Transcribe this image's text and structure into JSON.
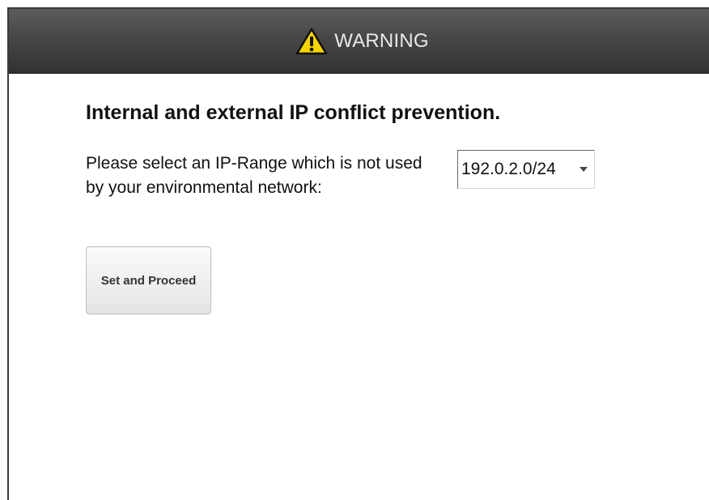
{
  "header": {
    "icon": "warning-triangle-icon",
    "icon_color": "#f5d300",
    "title": "WARNING"
  },
  "main": {
    "heading": "Internal and external IP conflict prevention.",
    "prompt": "Please select an IP-Range which is not used by your environmental network:",
    "ip_range_select": {
      "selected_value": "192.0.2.0/24"
    },
    "submit_button": {
      "label": "Set and Proceed"
    }
  }
}
